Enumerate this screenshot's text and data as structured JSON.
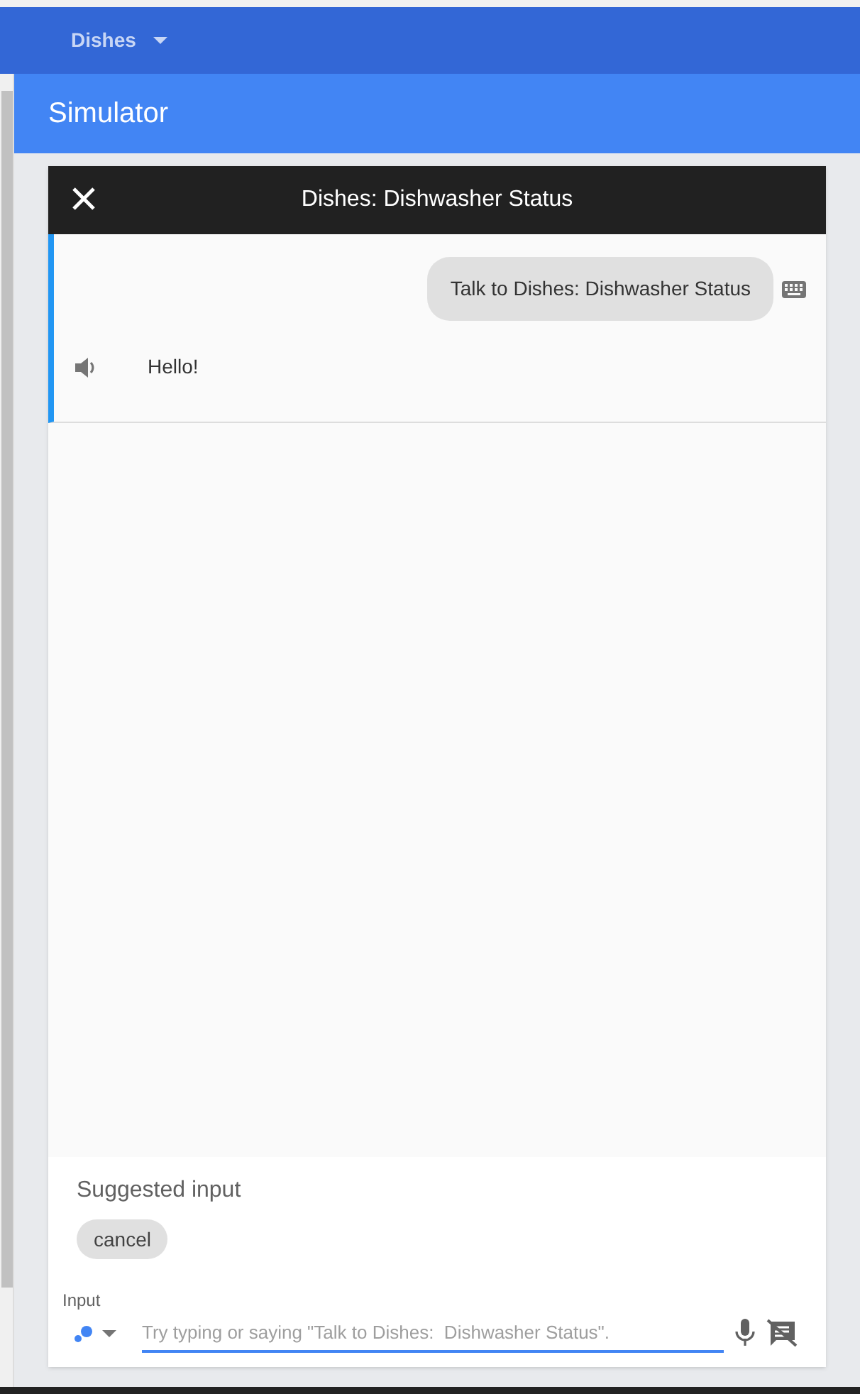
{
  "app_bar": {
    "project": "Dishes"
  },
  "header": {
    "title": "Simulator"
  },
  "simulator": {
    "title": "Dishes: Dishwasher Status",
    "messages": [
      {
        "kind": "user",
        "text": "Talk to Dishes: Dishwasher Status"
      },
      {
        "kind": "assistant",
        "text": "Hello!"
      }
    ],
    "suggested": {
      "title": "Suggested input",
      "chips": [
        "cancel"
      ]
    },
    "input": {
      "label": "Input",
      "placeholder": "Try typing or saying \"Talk to Dishes:  Dishwasher Status\"."
    }
  }
}
